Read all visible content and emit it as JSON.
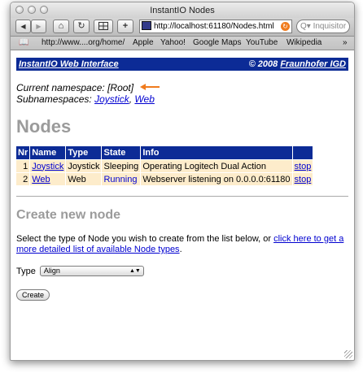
{
  "window": {
    "title": "InstantIO Nodes"
  },
  "toolbar": {
    "back_glyph": "◀",
    "forward_glyph": "▶",
    "home_glyph": "⌂",
    "reload_glyph": "↻",
    "add_glyph": "+",
    "address": "http://localhost:61180/Nodes.html",
    "search_placeholder": "Q▾ Inquisitor"
  },
  "bookmarks": {
    "items": [
      "http://www....org/home/",
      "Apple",
      "Yahoo!",
      "Google Maps",
      "YouTube",
      "Wikipedia"
    ],
    "more_glyph": "»"
  },
  "banner": {
    "left": "InstantIO Web Interface",
    "right_prefix": "© 2008 ",
    "right_link": "Fraunhofer IGD"
  },
  "namespace": {
    "current_label": "Current namespace: ",
    "current_value": "[Root]",
    "sub_label": "Subnamespaces: ",
    "subs": [
      "Joystick",
      "Web"
    ],
    "sub_separator": ", "
  },
  "nodes": {
    "heading": "Nodes",
    "columns": [
      "Nr",
      "Name",
      "Type",
      "State",
      "Info",
      ""
    ],
    "rows": [
      {
        "nr": "1",
        "name": "Joystick",
        "type": "Joystick",
        "state": "Sleeping",
        "info": "Operating Logitech Dual Action",
        "action": "stop"
      },
      {
        "nr": "2",
        "name": "Web",
        "type": "Web",
        "state": "Running",
        "info": "Webserver listening on 0.0.0.0:61180",
        "action": "stop"
      }
    ]
  },
  "create": {
    "heading": "Create new node",
    "desc_text": "Select the type of Node you wish to create from the list below, or ",
    "desc_link": "click here to get a more detailed list of available Node types",
    "desc_end": ".",
    "type_label": "Type",
    "type_value": "Align",
    "button": "Create"
  },
  "colors": {
    "banner": "#0c2b96",
    "row": "#fdeccb",
    "link": "#0000d0",
    "arrow": "#f07b1d",
    "heading": "#9b9b9b"
  }
}
